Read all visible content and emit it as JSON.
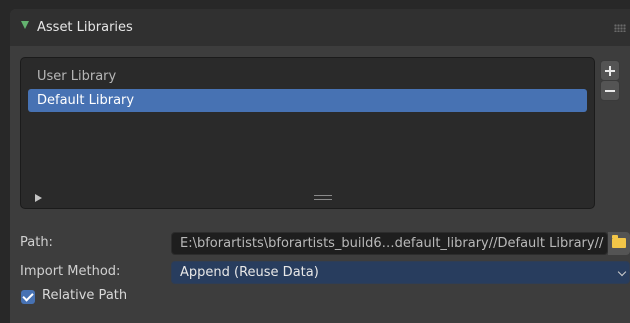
{
  "panel": {
    "title": "Asset Libraries"
  },
  "libraries": {
    "items": [
      {
        "label": "User Library",
        "selected": false
      },
      {
        "label": "Default Library",
        "selected": true
      }
    ]
  },
  "path": {
    "label": "Path:",
    "value": "E:\\bforartists\\bforartists_build6…default_library//Default Library//"
  },
  "import_method": {
    "label": "Import Method:",
    "value": "Append (Reuse Data)"
  },
  "relative_path": {
    "label": "Relative Path",
    "checked": true
  },
  "colors": {
    "accent": "#4772b3",
    "header_arrow": "#63b26f",
    "folder": "#f3c648"
  }
}
